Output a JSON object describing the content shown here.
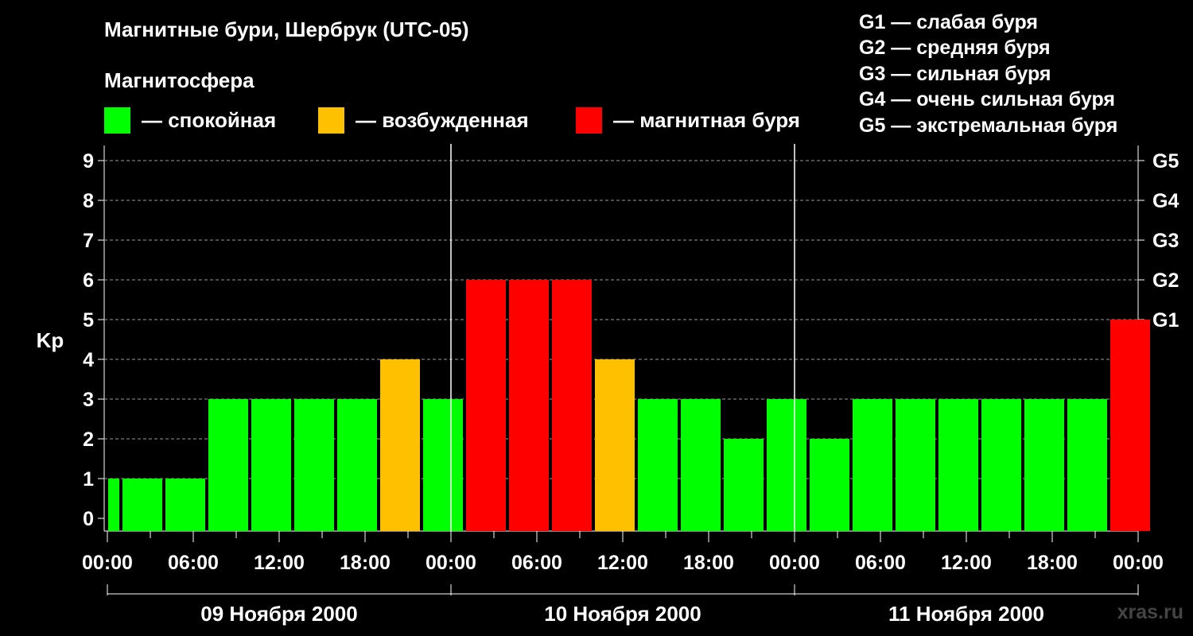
{
  "title": "Магнитные бури, Шербрук (UTC-05)",
  "magnetosphere_heading": "Магнитосфера",
  "legend": [
    {
      "label": "— спокойная",
      "color": "#00ff00"
    },
    {
      "label": "— возбужденная",
      "color": "#ffc000"
    },
    {
      "label": "— магнитная буря",
      "color": "#ff0000"
    }
  ],
  "g_scale": [
    "G1 — слабая буря",
    "G2 — средняя буря",
    "G3 — сильная буря",
    "G4 — очень сильная буря",
    "G5 — экстремальная буря"
  ],
  "watermark": "xras.ru",
  "chart_data": {
    "type": "bar",
    "ylabel": "Kp",
    "ylim": [
      0,
      9
    ],
    "yticks": [
      "0",
      "1",
      "2",
      "3",
      "4",
      "5",
      "6",
      "7",
      "8",
      "9"
    ],
    "right_labels": [
      {
        "kp": 5,
        "label": "G1"
      },
      {
        "kp": 6,
        "label": "G2"
      },
      {
        "kp": 7,
        "label": "G3"
      },
      {
        "kp": 8,
        "label": "G4"
      },
      {
        "kp": 9,
        "label": "G5"
      }
    ],
    "grid": "dashed horizontal",
    "xtick_labels": [
      "00:00",
      "06:00",
      "12:00",
      "18:00",
      "00:00",
      "06:00",
      "12:00",
      "18:00",
      "00:00",
      "06:00",
      "12:00",
      "18:00",
      "00:00"
    ],
    "day_labels": [
      "09 Ноября 2000",
      "10 Ноября 2000",
      "11 Ноября 2000"
    ],
    "colors": {
      "quiet": "#00ff00",
      "active": "#ffc000",
      "storm": "#ff0000"
    },
    "series": [
      {
        "start_hour": -2,
        "kp": 1,
        "level": "quiet"
      },
      {
        "start_hour": 1,
        "kp": 1,
        "level": "quiet"
      },
      {
        "start_hour": 4,
        "kp": 1,
        "level": "quiet"
      },
      {
        "start_hour": 7,
        "kp": 3,
        "level": "quiet"
      },
      {
        "start_hour": 10,
        "kp": 3,
        "level": "quiet"
      },
      {
        "start_hour": 13,
        "kp": 3,
        "level": "quiet"
      },
      {
        "start_hour": 16,
        "kp": 3,
        "level": "quiet"
      },
      {
        "start_hour": 19,
        "kp": 4,
        "level": "active"
      },
      {
        "start_hour": 22,
        "kp": 3,
        "level": "quiet"
      },
      {
        "start_hour": 25,
        "kp": 6,
        "level": "storm"
      },
      {
        "start_hour": 28,
        "kp": 6,
        "level": "storm"
      },
      {
        "start_hour": 31,
        "kp": 6,
        "level": "storm"
      },
      {
        "start_hour": 34,
        "kp": 4,
        "level": "active"
      },
      {
        "start_hour": 37,
        "kp": 3,
        "level": "quiet"
      },
      {
        "start_hour": 40,
        "kp": 3,
        "level": "quiet"
      },
      {
        "start_hour": 43,
        "kp": 2,
        "level": "quiet"
      },
      {
        "start_hour": 46,
        "kp": 3,
        "level": "quiet"
      },
      {
        "start_hour": 49,
        "kp": 2,
        "level": "quiet"
      },
      {
        "start_hour": 52,
        "kp": 3,
        "level": "quiet"
      },
      {
        "start_hour": 55,
        "kp": 3,
        "level": "quiet"
      },
      {
        "start_hour": 58,
        "kp": 3,
        "level": "quiet"
      },
      {
        "start_hour": 61,
        "kp": 3,
        "level": "quiet"
      },
      {
        "start_hour": 64,
        "kp": 3,
        "level": "quiet"
      },
      {
        "start_hour": 67,
        "kp": 3,
        "level": "quiet"
      },
      {
        "start_hour": 70,
        "kp": 5,
        "level": "storm"
      }
    ]
  }
}
